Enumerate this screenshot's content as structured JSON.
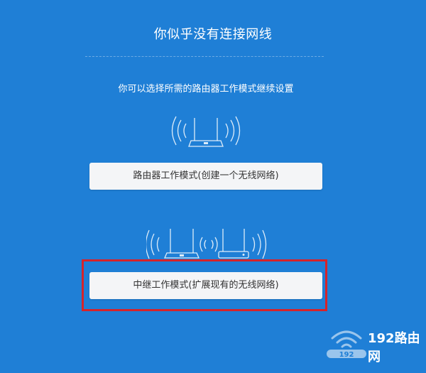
{
  "title": "你似乎没有连接网线",
  "subtitle": "你可以选择所需的路由器工作模式继续设置",
  "modes": {
    "router": {
      "label": "路由器工作模式(创建一个无线网络)",
      "icon": "router-icon"
    },
    "repeater": {
      "label": "中继工作模式(扩展现有的无线网络)",
      "icon": "repeater-icon",
      "highlighted": true
    }
  },
  "watermark": {
    "brand": "192路由网",
    "badge": "192"
  },
  "colors": {
    "background": "#1f7fd6",
    "button_bg": "#f4f5f7",
    "button_text": "#333333",
    "highlight": "#d6232a"
  }
}
